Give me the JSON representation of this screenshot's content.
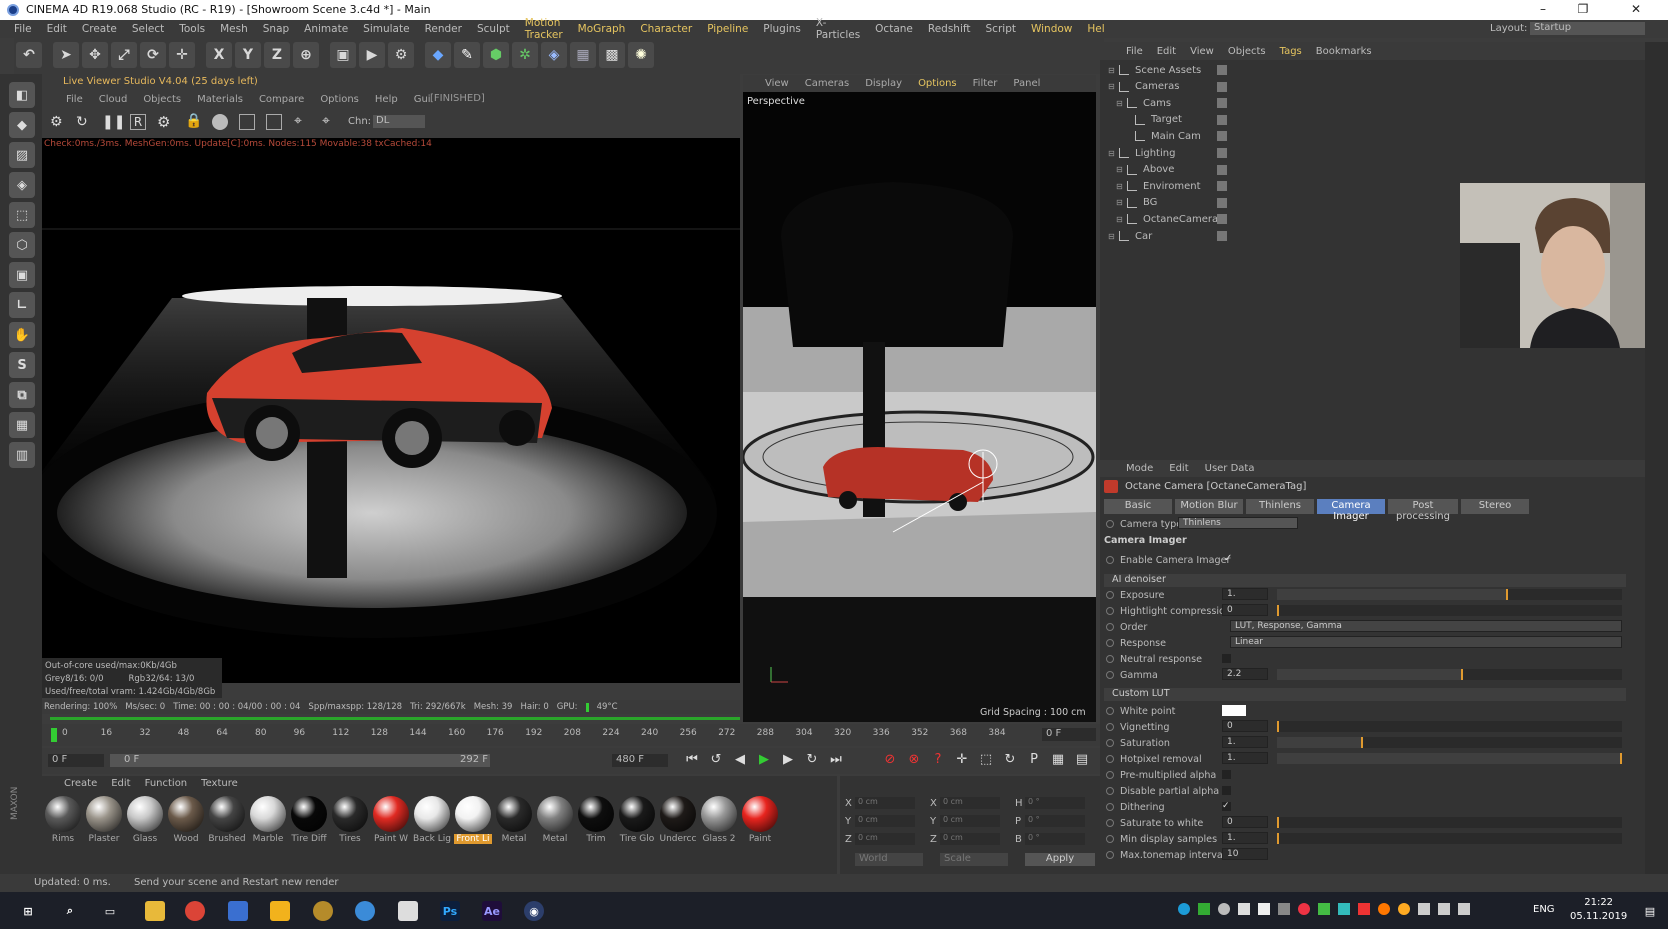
{
  "window": {
    "title": "CINEMA 4D R19.068 Studio (RC - R19) - [Showroom Scene 3.c4d *] - Main"
  },
  "menu": [
    "File",
    "Edit",
    "Create",
    "Select",
    "Tools",
    "Mesh",
    "Snap",
    "Animate",
    "Simulate",
    "Render",
    "Sculpt",
    "Motion Tracker",
    "MoGraph",
    "Character",
    "Pipeline",
    "Plugins",
    "X-Particles",
    "Octane",
    "Redshift",
    "Script",
    "Window",
    "Help"
  ],
  "menu_highlight": [
    "Motion Tracker",
    "MoGraph",
    "Character",
    "Pipeline",
    "Window",
    "Help"
  ],
  "layout": {
    "label": "Layout:",
    "value": "Startup"
  },
  "toolbar_icons": [
    "undo-icon",
    "select-icon",
    "move-icon",
    "scale-icon",
    "rotate-icon",
    "move-all-icon",
    "x-axis-icon",
    "y-axis-icon",
    "z-axis-icon",
    "world-icon",
    "render-view-icon",
    "render-picture-icon",
    "render-settings-icon",
    "cube-icon",
    "pen-icon",
    "subdivision-icon",
    "array-icon",
    "deformer-icon",
    "floor-icon",
    "camera-icon",
    "light-icon"
  ],
  "live_viewer": {
    "title": "Live Viewer Studio V4.04 (25 days left)",
    "menu": [
      "File",
      "Cloud",
      "Objects",
      "Materials",
      "Compare",
      "Options",
      "Help",
      "Gui"
    ],
    "state": "[FINISHED]",
    "chn_label": "Chn:",
    "chn_value": "DL",
    "stats_line": "Check:0ms./3ms. MeshGen:0ms. Update[C]:0ms. Nodes:115 Movable:38 txCached:14",
    "info": {
      "out_of_core": "Out-of-core used/max:0Kb/4Gb",
      "grey": "Grey8/16: 0/0",
      "rgb": "Rgb32/64: 13/0",
      "vram": "Used/free/total vram: 1.424Gb/4Gb/8Gb"
    },
    "render_bar": {
      "rendering": "Rendering: 100%",
      "ms_sec": "Ms/sec: 0",
      "time": "Time: 00 : 00 : 04/00 : 00 : 04",
      "spp": "Spp/maxspp: 128/128",
      "tri": "Tri: 292/667k",
      "mesh": "Mesh: 39",
      "hair": "Hair: 0",
      "gpu": "GPU:",
      "temp": "49°C"
    }
  },
  "viewport": {
    "menu": [
      "View",
      "Cameras",
      "Display",
      "Options",
      "Filter",
      "Panel"
    ],
    "label": "Perspective",
    "grid": "Grid Spacing : 100 cm"
  },
  "timeline": {
    "ticks": [
      "0",
      "16",
      "32",
      "48",
      "64",
      "80",
      "96",
      "112",
      "128",
      "144",
      "160",
      "176",
      "192",
      "208",
      "224",
      "240",
      "256",
      "272",
      "288",
      "304",
      "320",
      "336",
      "352",
      "368",
      "384"
    ],
    "frame_field": "0 F",
    "start": "0 F",
    "range_start": "0 F",
    "range_end": "292 F",
    "end": "480 F"
  },
  "objects": {
    "menu": [
      "File",
      "Edit",
      "View",
      "Objects",
      "Tags",
      "Bookmarks"
    ],
    "tree": [
      {
        "name": "Scene Assets",
        "indent": 0
      },
      {
        "name": "Cameras",
        "indent": 0
      },
      {
        "name": "Cams",
        "indent": 1
      },
      {
        "name": "Target",
        "indent": 2
      },
      {
        "name": "Main Cam",
        "indent": 2
      },
      {
        "name": "Lighting",
        "indent": 0
      },
      {
        "name": "Above",
        "indent": 1
      },
      {
        "name": "Enviroment",
        "indent": 1
      },
      {
        "name": "BG",
        "indent": 1
      },
      {
        "name": "OctaneCamera",
        "indent": 1
      },
      {
        "name": "Car",
        "indent": 0
      }
    ]
  },
  "attributes": {
    "menu": [
      "Mode",
      "Edit",
      "User Data"
    ],
    "title": "Octane Camera [OctaneCameraTag]",
    "tabs": [
      "Basic",
      "Motion Blur",
      "Thinlens",
      "Camera Imager",
      "Post processing",
      "Stereo"
    ],
    "active_tab": "Camera Imager",
    "camera_type_label": "Camera type",
    "camera_type": "Thinlens",
    "section": "Camera Imager",
    "enable_label": "Enable Camera Imager",
    "ai_denoiser": "AI denoiser",
    "rows": [
      {
        "label": "Exposure",
        "value": "1.",
        "fill": 0.67
      },
      {
        "label": "Hightlight compression",
        "value": "0",
        "fill": 0.0
      },
      {
        "label": "Order",
        "value": "LUT, Response, Gamma"
      },
      {
        "label": "Response",
        "value": "Linear"
      },
      {
        "label": "Neutral response",
        "value": ""
      },
      {
        "label": "Gamma",
        "value": "2.2",
        "fill": 0.54
      }
    ],
    "custom_lut": "Custom LUT",
    "rows2": [
      {
        "label": "White point",
        "value": ""
      },
      {
        "label": "Vignetting",
        "value": "0",
        "fill": 0.0
      },
      {
        "label": "Saturation",
        "value": "1.",
        "fill": 0.25
      },
      {
        "label": "Hotpixel removal",
        "value": "1.",
        "fill": 1.0
      },
      {
        "label": "Pre-multiplied alpha",
        "value": ""
      },
      {
        "label": "Disable partial alpha",
        "value": ""
      },
      {
        "label": "Dithering",
        "value": ""
      },
      {
        "label": "Saturate to white",
        "value": "0",
        "fill": 0.0
      },
      {
        "label": "Min display samples",
        "value": "1.",
        "fill": 0.0
      },
      {
        "label": "Max.tonemap interval",
        "value": "10"
      }
    ]
  },
  "materials": {
    "menu": [
      "Create",
      "Edit",
      "Function",
      "Texture"
    ],
    "items": [
      {
        "name": "Rims",
        "color": "#5a5a5a"
      },
      {
        "name": "Plaster",
        "color": "#9a948a"
      },
      {
        "name": "Glass",
        "color": "#c8c8c8"
      },
      {
        "name": "Wood",
        "color": "#6b5a4a"
      },
      {
        "name": "Brushed",
        "color": "#444444"
      },
      {
        "name": "Marble",
        "color": "#d8d8d8"
      },
      {
        "name": "Tire Diff",
        "color": "#080808"
      },
      {
        "name": "Tires",
        "color": "#2a2a2a"
      },
      {
        "name": "Paint W",
        "color": "#e02a22"
      },
      {
        "name": "Back Lig",
        "color": "#e8e8e8"
      },
      {
        "name": "Front Li",
        "color": "#f2f2f2"
      },
      {
        "name": "Metal",
        "color": "#2a2a2a"
      },
      {
        "name": "Metal",
        "color": "#808080"
      },
      {
        "name": "Trim",
        "color": "#0e0e0e"
      },
      {
        "name": "Tire Glo",
        "color": "#1a1a1a"
      },
      {
        "name": "Undercc",
        "color": "#1e1a18"
      },
      {
        "name": "Glass 2",
        "color": "#999999"
      },
      {
        "name": "Paint",
        "color": "#e8241e"
      }
    ],
    "selected": "Front Li"
  },
  "coords": {
    "x": "X",
    "y": "Y",
    "z": "Z",
    "h": "H",
    "p": "P",
    "b": "B",
    "v_cm": "0 cm",
    "v_deg": "0 °",
    "world": "World",
    "scale": "Scale",
    "apply": "Apply"
  },
  "status": {
    "updated": "Updated: 0 ms.",
    "message": "Send your scene and Restart new render"
  },
  "taskbar": {
    "time": "21:22",
    "date": "05.11.2019",
    "lang": "ENG"
  }
}
